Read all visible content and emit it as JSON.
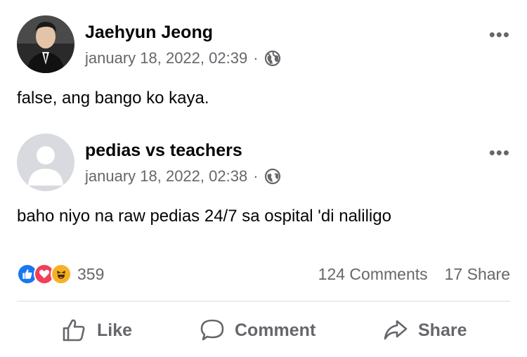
{
  "posts": [
    {
      "author": "Jaehyun Jeong",
      "timestamp": "january 18, 2022, 02:39",
      "separator": "·",
      "privacy_icon": "globe-icon",
      "more_label": "•••",
      "text": "false, ang bango ko kaya.",
      "avatar": "photo"
    },
    {
      "author": "pedias vs teachers",
      "timestamp": "january 18, 2022, 02:38",
      "separator": "·",
      "privacy_icon": "globe-icon",
      "more_label": "•••",
      "text": "baho niyo na raw pedias 24/7 sa ospital 'di naliligo",
      "avatar": "default-silhouette"
    }
  ],
  "stats": {
    "reaction_count": "359",
    "reactions": [
      "like",
      "love",
      "haha"
    ],
    "comments": "124 Comments",
    "shares": "17 Share"
  },
  "actions": {
    "like_label": "Like",
    "comment_label": "Comment",
    "share_label": "Share"
  },
  "colors": {
    "text": "#050505",
    "secondary": "#65676b",
    "like_blue": "#1877f2",
    "love_red": "#f33e58",
    "haha_yellow": "#f7b125",
    "divider": "#dadde1"
  }
}
